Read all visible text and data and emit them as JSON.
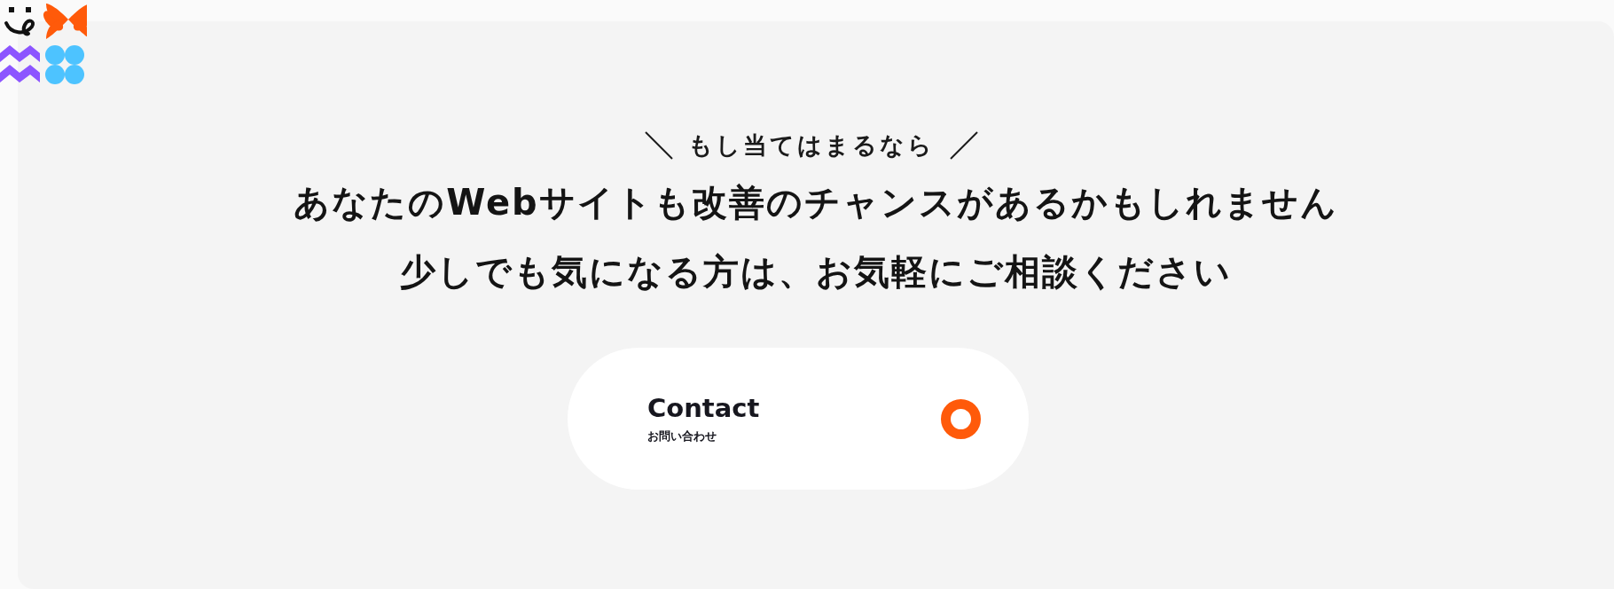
{
  "tagline": "もし当てはまるなら",
  "heading_lines": [
    "あなたのWebサイトも改善のチャンスがあるかもしれません",
    "少しでも気になる方は、お気軽にご相談ください"
  ],
  "contact_button": {
    "label": "Contact",
    "sublabel": "お問い合わせ"
  }
}
